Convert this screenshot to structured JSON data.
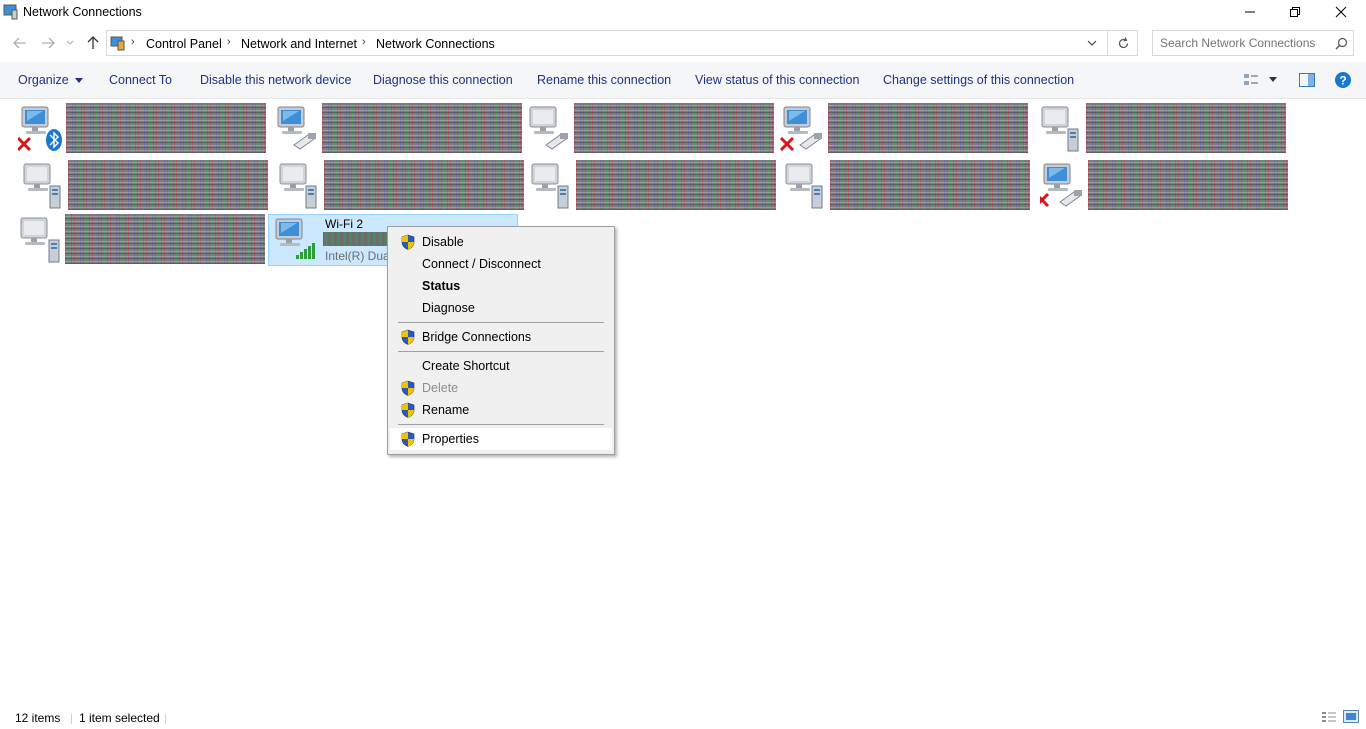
{
  "window": {
    "title": "Network Connections"
  },
  "breadcrumb": [
    "Control Panel",
    "Network and Internet",
    "Network Connections"
  ],
  "search": {
    "placeholder": "Search Network Connections"
  },
  "toolbar": {
    "organize": "Organize",
    "items": [
      "Connect To",
      "Disable this network device",
      "Diagnose this connection",
      "Rename this connection",
      "View status of this connection",
      "Change settings of this connection"
    ]
  },
  "selected_connection": {
    "name": "Wi-Fi 2",
    "description": "Intel(R) Dua"
  },
  "context_menu": {
    "disable": "Disable",
    "connect_disconnect": "Connect / Disconnect",
    "status": "Status",
    "diagnose": "Diagnose",
    "bridge": "Bridge Connections",
    "shortcut": "Create Shortcut",
    "delete": "Delete",
    "rename": "Rename",
    "properties": "Properties"
  },
  "status_bar": {
    "item_count": "12 items",
    "selection": "1 item selected"
  },
  "colors": {
    "toolbar_text": "#1e3287",
    "selection_bg": "#cce8ff",
    "selection_border": "#99d1ff",
    "help_blue": "#1877d2"
  }
}
